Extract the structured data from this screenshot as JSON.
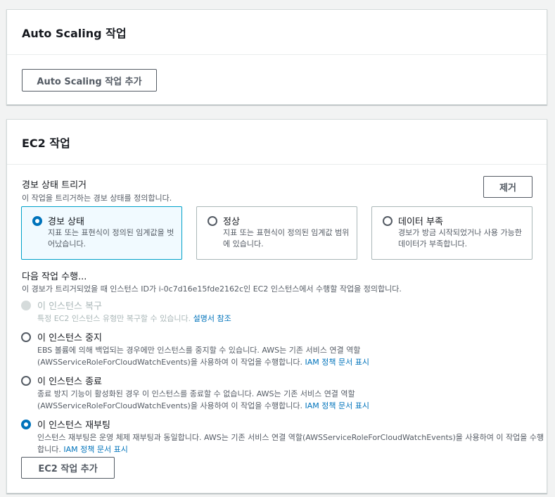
{
  "autoscaling": {
    "title": "Auto Scaling 작업",
    "add_button": "Auto Scaling 작업 추가"
  },
  "ec2": {
    "title": "EC2 작업",
    "trigger_label": "경보 상태 트리거",
    "trigger_desc": "이 작업을 트리거하는 경보 상태를 정의합니다.",
    "remove_button": "제거",
    "states": [
      {
        "title": "경보 상태",
        "desc": "지표 또는 표현식이 정의된 임계값을 벗어났습니다.",
        "selected": true
      },
      {
        "title": "정상",
        "desc": "지표 또는 표현식이 정의된 임계값 범위에 있습니다.",
        "selected": false
      },
      {
        "title": "데이터 부족",
        "desc": "경보가 방금 시작되었거나 사용 가능한 데이터가 부족합니다.",
        "selected": false
      }
    ],
    "action_label": "다음 작업 수행...",
    "action_desc": "이 경보가 트리거되었을 때 인스턴스 ID가 i-0c7d16e15fde2162c인 EC2 인스턴스에서 수행할 작업을 정의합니다.",
    "options": [
      {
        "title": "이 인스턴스 복구",
        "desc": "특정 EC2 인스턴스 유형만 복구할 수 있습니다. ",
        "link": "설명서 참조",
        "state": "disabled"
      },
      {
        "title": "이 인스턴스 중지",
        "desc": "EBS 볼륨에 의해 백업되는 경우에만 인스턴스를 중지할 수 있습니다. AWS는 기존 서비스 연결 역할(AWSServiceRoleForCloudWatchEvents)을 사용하여 이 작업을 수행합니다. ",
        "link": "IAM 정책 문서 표시",
        "state": "off"
      },
      {
        "title": "이 인스턴스 종료",
        "desc": "종료 방지 기능이 활성화된 경우 이 인스턴스를 종료할 수 없습니다. AWS는 기존 서비스 연결 역할(AWSServiceRoleForCloudWatchEvents)을 사용하여 이 작업을 수행합니다. ",
        "link": "IAM 정책 문서 표시",
        "state": "off"
      },
      {
        "title": "이 인스턴스 재부팅",
        "desc": "인스턴스 재부팅은 운영 체제 재부팅과 동일합니다. AWS는 기존 서비스 연결 역할(AWSServiceRoleForCloudWatchEvents)을 사용하여 이 작업을 수행합니다. ",
        "link": "IAM 정책 문서 표시",
        "state": "on"
      }
    ],
    "add_button": "EC2 작업 추가"
  }
}
